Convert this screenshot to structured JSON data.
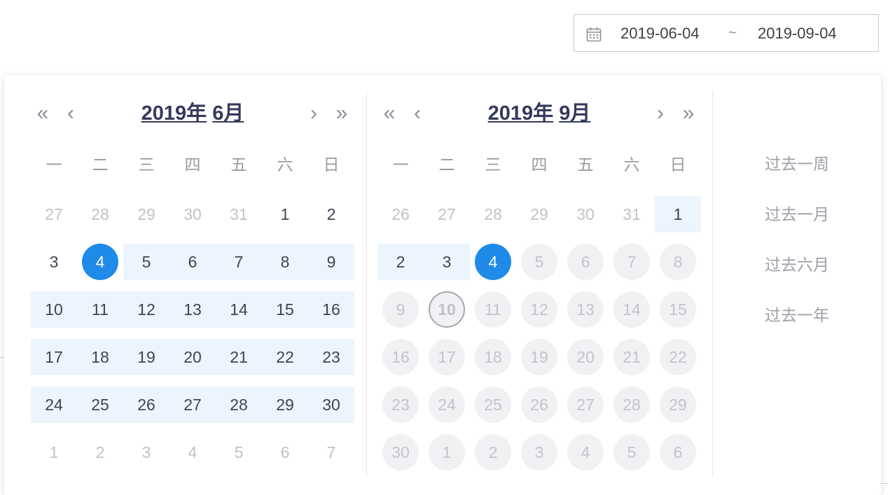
{
  "range_input": {
    "icon": "calendar-icon",
    "start": "2019-06-04",
    "separator": "~",
    "end": "2019-09-04"
  },
  "weekday_labels": [
    "一",
    "二",
    "三",
    "四",
    "五",
    "六",
    "日"
  ],
  "left_calendar": {
    "year_label": "2019年",
    "month_label": "6月",
    "nav": {
      "prev_year": "«",
      "prev_month": "‹",
      "next_month": "›",
      "next_year": "»"
    },
    "weeks": [
      [
        {
          "d": "27",
          "s": "other"
        },
        {
          "d": "28",
          "s": "other"
        },
        {
          "d": "29",
          "s": "other"
        },
        {
          "d": "30",
          "s": "other"
        },
        {
          "d": "31",
          "s": "other"
        },
        {
          "d": "1",
          "s": "normal"
        },
        {
          "d": "2",
          "s": "normal"
        }
      ],
      [
        {
          "d": "3",
          "s": "normal"
        },
        {
          "d": "4",
          "s": "selected"
        },
        {
          "d": "5",
          "s": "range"
        },
        {
          "d": "6",
          "s": "range"
        },
        {
          "d": "7",
          "s": "range"
        },
        {
          "d": "8",
          "s": "range"
        },
        {
          "d": "9",
          "s": "range"
        }
      ],
      [
        {
          "d": "10",
          "s": "range"
        },
        {
          "d": "11",
          "s": "range"
        },
        {
          "d": "12",
          "s": "range"
        },
        {
          "d": "13",
          "s": "range"
        },
        {
          "d": "14",
          "s": "range"
        },
        {
          "d": "15",
          "s": "range"
        },
        {
          "d": "16",
          "s": "range"
        }
      ],
      [
        {
          "d": "17",
          "s": "range"
        },
        {
          "d": "18",
          "s": "range"
        },
        {
          "d": "19",
          "s": "range"
        },
        {
          "d": "20",
          "s": "range"
        },
        {
          "d": "21",
          "s": "range"
        },
        {
          "d": "22",
          "s": "range"
        },
        {
          "d": "23",
          "s": "range"
        }
      ],
      [
        {
          "d": "24",
          "s": "range"
        },
        {
          "d": "25",
          "s": "range"
        },
        {
          "d": "26",
          "s": "range"
        },
        {
          "d": "27",
          "s": "range"
        },
        {
          "d": "28",
          "s": "range"
        },
        {
          "d": "29",
          "s": "range"
        },
        {
          "d": "30",
          "s": "range"
        }
      ],
      [
        {
          "d": "1",
          "s": "other"
        },
        {
          "d": "2",
          "s": "other"
        },
        {
          "d": "3",
          "s": "other"
        },
        {
          "d": "4",
          "s": "other"
        },
        {
          "d": "5",
          "s": "other"
        },
        {
          "d": "6",
          "s": "other"
        },
        {
          "d": "7",
          "s": "other"
        }
      ]
    ]
  },
  "right_calendar": {
    "year_label": "2019年",
    "month_label": "9月",
    "nav": {
      "prev_year": "«",
      "prev_month": "‹",
      "next_month": "›",
      "next_year": "»"
    },
    "weeks": [
      [
        {
          "d": "26",
          "s": "other"
        },
        {
          "d": "27",
          "s": "other"
        },
        {
          "d": "28",
          "s": "other"
        },
        {
          "d": "29",
          "s": "other"
        },
        {
          "d": "30",
          "s": "other"
        },
        {
          "d": "31",
          "s": "other"
        },
        {
          "d": "1",
          "s": "range"
        }
      ],
      [
        {
          "d": "2",
          "s": "range"
        },
        {
          "d": "3",
          "s": "range"
        },
        {
          "d": "4",
          "s": "selected"
        },
        {
          "d": "5",
          "s": "disabled"
        },
        {
          "d": "6",
          "s": "disabled"
        },
        {
          "d": "7",
          "s": "disabled"
        },
        {
          "d": "8",
          "s": "disabled"
        }
      ],
      [
        {
          "d": "9",
          "s": "disabled"
        },
        {
          "d": "10",
          "s": "today"
        },
        {
          "d": "11",
          "s": "disabled"
        },
        {
          "d": "12",
          "s": "disabled"
        },
        {
          "d": "13",
          "s": "disabled"
        },
        {
          "d": "14",
          "s": "disabled"
        },
        {
          "d": "15",
          "s": "disabled"
        }
      ],
      [
        {
          "d": "16",
          "s": "disabled"
        },
        {
          "d": "17",
          "s": "disabled"
        },
        {
          "d": "18",
          "s": "disabled"
        },
        {
          "d": "19",
          "s": "disabled"
        },
        {
          "d": "20",
          "s": "disabled"
        },
        {
          "d": "21",
          "s": "disabled"
        },
        {
          "d": "22",
          "s": "disabled"
        }
      ],
      [
        {
          "d": "23",
          "s": "disabled"
        },
        {
          "d": "24",
          "s": "disabled"
        },
        {
          "d": "25",
          "s": "disabled"
        },
        {
          "d": "26",
          "s": "disabled"
        },
        {
          "d": "27",
          "s": "disabled"
        },
        {
          "d": "28",
          "s": "disabled"
        },
        {
          "d": "29",
          "s": "disabled"
        }
      ],
      [
        {
          "d": "30",
          "s": "disabled"
        },
        {
          "d": "1",
          "s": "disabled"
        },
        {
          "d": "2",
          "s": "disabled"
        },
        {
          "d": "3",
          "s": "disabled"
        },
        {
          "d": "4",
          "s": "disabled"
        },
        {
          "d": "5",
          "s": "disabled"
        },
        {
          "d": "6",
          "s": "disabled"
        }
      ]
    ]
  },
  "shortcuts": [
    "过去一周",
    "过去一月",
    "过去六月",
    "过去一年"
  ],
  "colors": {
    "accent": "#1f8ae8",
    "range_bg": "#ecf5fd",
    "disabled_bg": "#f1f1f3",
    "title": "#353a5c"
  }
}
